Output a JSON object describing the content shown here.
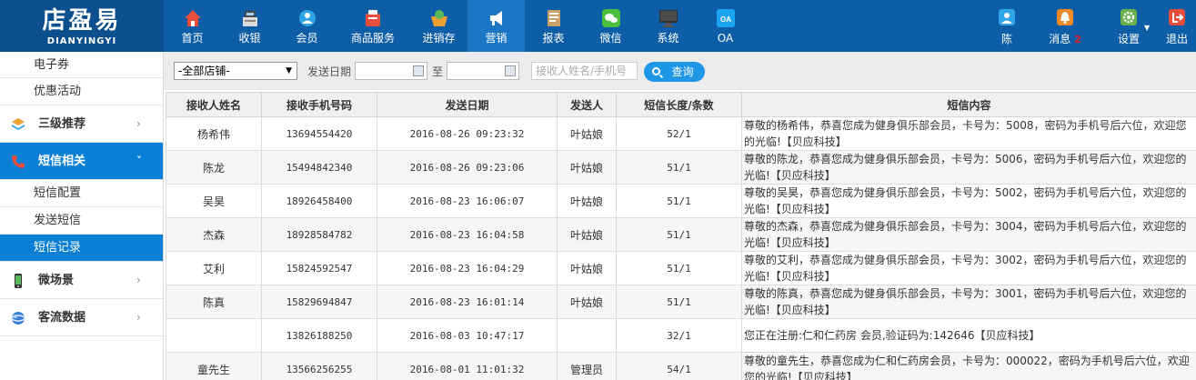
{
  "logo": {
    "cn": "店盈易",
    "en": "DIANYINGYI"
  },
  "nav": [
    {
      "label": "首页",
      "icon": "home-icon"
    },
    {
      "label": "收银",
      "icon": "cash-register-icon"
    },
    {
      "label": "会员",
      "icon": "member-icon"
    },
    {
      "label": "商品服务",
      "icon": "goods-icon"
    },
    {
      "label": "进销存",
      "icon": "inventory-icon"
    },
    {
      "label": "营销",
      "icon": "megaphone-icon"
    },
    {
      "label": "报表",
      "icon": "report-icon"
    },
    {
      "label": "微信",
      "icon": "wechat-icon"
    },
    {
      "label": "系统",
      "icon": "monitor-icon"
    },
    {
      "label": "OA",
      "icon": "oa-icon"
    }
  ],
  "user": {
    "name": "陈"
  },
  "messages": {
    "label": "消息",
    "count": "2"
  },
  "settings": {
    "label": "设置"
  },
  "logout": {
    "label": "退出"
  },
  "sidebar": {
    "top_items": [
      "电子券",
      "优惠活动"
    ],
    "groups": [
      {
        "label": "三级推荐",
        "icon": "layers-icon"
      },
      {
        "label": "短信相关",
        "icon": "phone-icon"
      }
    ],
    "sms_items": [
      "短信配置",
      "发送短信",
      "短信记录"
    ],
    "bottom_groups": [
      {
        "label": "微场景",
        "icon": "mobile-icon"
      },
      {
        "label": "客流数据",
        "icon": "globe-icon"
      }
    ]
  },
  "filter": {
    "store": "-全部店铺-",
    "date_label": "发送日期",
    "to_label": "至",
    "keyword_placeholder": "接收人姓名/手机号",
    "query_label": "查询"
  },
  "table": {
    "headers": [
      "接收人姓名",
      "接收手机号码",
      "发送日期",
      "发送人",
      "短信长度/条数",
      "短信内容"
    ],
    "rows": [
      {
        "name": "杨希伟",
        "phone": "13694554420",
        "date": "2016-08-26 09:23:32",
        "sender": "叶姑娘",
        "len": "52/1",
        "content": "尊敬的杨希伟，恭喜您成为健身俱乐部会员，卡号为：5008，密码为手机号后六位，欢迎您的光临!【贝应科技】"
      },
      {
        "name": "陈龙",
        "phone": "15494842340",
        "date": "2016-08-26 09:23:06",
        "sender": "叶姑娘",
        "len": "51/1",
        "content": "尊敬的陈龙，恭喜您成为健身俱乐部会员，卡号为：5006，密码为手机号后六位，欢迎您的光临!【贝应科技】"
      },
      {
        "name": "吴昊",
        "phone": "18926458400",
        "date": "2016-08-23 16:06:07",
        "sender": "叶姑娘",
        "len": "51/1",
        "content": "尊敬的吴昊，恭喜您成为健身俱乐部会员，卡号为：5002，密码为手机号后六位，欢迎您的光临!【贝应科技】"
      },
      {
        "name": "杰森",
        "phone": "18928584782",
        "date": "2016-08-23 16:04:58",
        "sender": "叶姑娘",
        "len": "51/1",
        "content": "尊敬的杰森，恭喜您成为健身俱乐部会员，卡号为：3004，密码为手机号后六位，欢迎您的光临!【贝应科技】"
      },
      {
        "name": "艾利",
        "phone": "15824592547",
        "date": "2016-08-23 16:04:29",
        "sender": "叶姑娘",
        "len": "51/1",
        "content": "尊敬的艾利，恭喜您成为健身俱乐部会员，卡号为：3002，密码为手机号后六位，欢迎您的光临!【贝应科技】"
      },
      {
        "name": "陈真",
        "phone": "15829694847",
        "date": "2016-08-23 16:01:14",
        "sender": "叶姑娘",
        "len": "51/1",
        "content": "尊敬的陈真，恭喜您成为健身俱乐部会员，卡号为：3001，密码为手机号后六位，欢迎您的光临!【贝应科技】"
      },
      {
        "name": "",
        "phone": "13826188250",
        "date": "2016-08-03 10:47:17",
        "sender": "",
        "len": "32/1",
        "content": "您正在注册:仁和仁药房 会员,验证码为:142646【贝应科技】"
      },
      {
        "name": "童先生",
        "phone": "13566256255",
        "date": "2016-08-01 11:01:32",
        "sender": "管理员",
        "len": "54/1",
        "content": "尊敬的童先生，恭喜您成为仁和仁药房会员，卡号为：000022，密码为手机号后六位，欢迎您的光临!【贝应科技】"
      }
    ]
  },
  "colors": {
    "topbar": "#0d5ea6",
    "active": "#0a7fd6",
    "query_button": "#1d97e6"
  }
}
